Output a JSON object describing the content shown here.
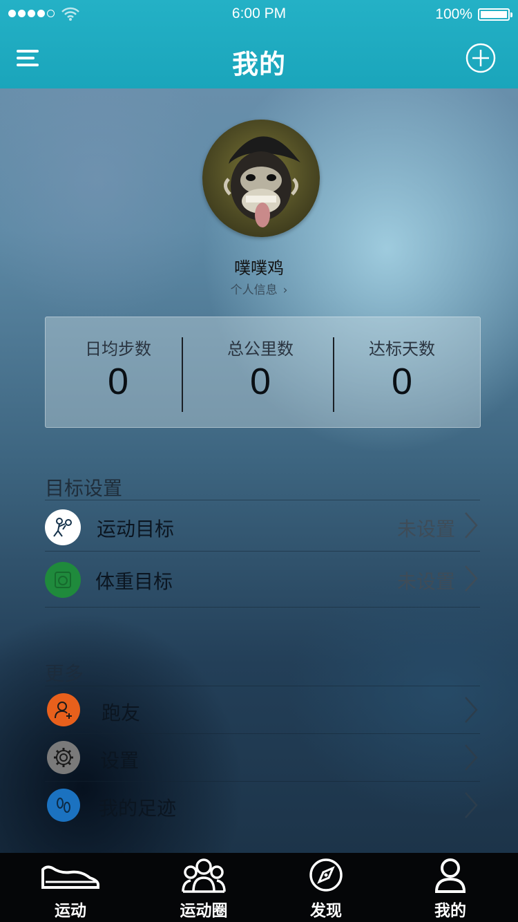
{
  "status_bar": {
    "time": "6:00 PM",
    "battery": "100%"
  },
  "header": {
    "title": "我的"
  },
  "profile": {
    "name": "噗噗鸡",
    "info_link": "个人信息"
  },
  "stats": [
    {
      "label": "日均步数",
      "value": "0"
    },
    {
      "label": "总公里数",
      "value": "0"
    },
    {
      "label": "达标天数",
      "value": "0"
    }
  ],
  "goals": {
    "title": "目标设置",
    "items": [
      {
        "label": "运动目标",
        "value": "未设置",
        "icon": "exercise-icon",
        "color": "#ffffff"
      },
      {
        "label": "体重目标",
        "value": "未设置",
        "icon": "scale-icon",
        "color": "#1f8a3c"
      }
    ]
  },
  "more": {
    "title": "更多",
    "items": [
      {
        "label": "跑友",
        "icon": "add-friend-icon",
        "color": "#e8601c"
      },
      {
        "label": "设置",
        "icon": "gear-icon",
        "color": "#7a7a7a"
      },
      {
        "label": "我的足迹",
        "icon": "footprint-icon",
        "color": "#1b72c0"
      }
    ]
  },
  "tabs": [
    {
      "label": "运动",
      "icon": "sneaker-icon"
    },
    {
      "label": "运动圈",
      "icon": "group-icon"
    },
    {
      "label": "发现",
      "icon": "compass-icon"
    },
    {
      "label": "我的",
      "icon": "person-icon"
    }
  ]
}
